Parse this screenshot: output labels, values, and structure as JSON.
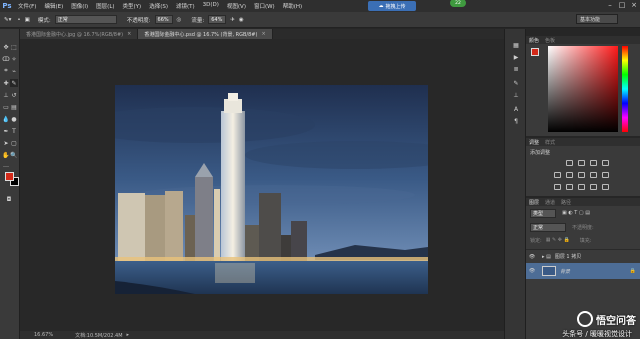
{
  "app": {
    "logo": "Ps"
  },
  "menu": [
    "文件(F)",
    "编辑(E)",
    "图像(I)",
    "图层(L)",
    "类型(Y)",
    "选择(S)",
    "滤镜(T)",
    "3D(D)",
    "视图(V)",
    "窗口(W)",
    "帮助(H)"
  ],
  "upload_button": "拖拽上传",
  "badge": "22",
  "options": {
    "mode_label": "模式:",
    "mode_value": "正常",
    "opacity_label": "不透明度:",
    "opacity_value": "66%",
    "flow_label": "流量:",
    "flow_value": "64%",
    "workspace": "基本功能"
  },
  "tabs": [
    {
      "label": "香港国际金融中心.jpg @ 16.7%(RGB/8#)",
      "active": false
    },
    {
      "label": "香港国际金融中心.psd @ 16.7% (背景, RGB/8#)",
      "active": true
    }
  ],
  "status": {
    "zoom": "16.67%",
    "doc": "文档:10.5M/202.4M"
  },
  "panels": {
    "color_tabs": [
      "颜色",
      "色板"
    ],
    "adjust_tabs": [
      "调整",
      "样式"
    ],
    "adjust_title": "添加调整",
    "layers_tabs": [
      "图层",
      "通道",
      "路径"
    ],
    "layer_kind": "类型",
    "blend_mode": "正常",
    "opacity_label": "不透明度:",
    "lock_label": "锁定:",
    "fill_label": "填充:",
    "layer_copy": "图层 1 拷贝",
    "layer_bg": "背景"
  },
  "watermark": {
    "brand": "悟空问答",
    "sub": "头条号 / 暖暖视觉设计"
  },
  "colors": {
    "foreground": "#d42a1a",
    "background": "#000000",
    "accent": "#3b6fb5"
  }
}
